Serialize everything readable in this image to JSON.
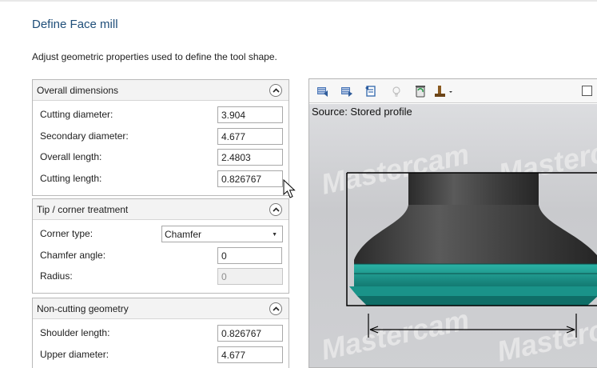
{
  "header": {
    "title": "Define Face mill",
    "description": "Adjust geometric properties used to define the tool shape."
  },
  "sections": {
    "overall": {
      "title": "Overall dimensions",
      "cutting_diameter": {
        "label": "Cutting diameter:",
        "value": "3.904"
      },
      "secondary_diameter": {
        "label": "Secondary diameter:",
        "value": "4.677"
      },
      "overall_length": {
        "label": "Overall length:",
        "value": "2.4803"
      },
      "cutting_length": {
        "label": "Cutting length:",
        "value": "0.826767"
      }
    },
    "tip": {
      "title": "Tip / corner treatment",
      "corner_type": {
        "label": "Corner type:",
        "value": "Chamfer"
      },
      "chamfer_angle": {
        "label": "Chamfer angle:",
        "value": "0"
      },
      "radius": {
        "label": "Radius:",
        "value": "0"
      }
    },
    "noncutting": {
      "title": "Non-cutting geometry",
      "shoulder_length": {
        "label": "Shoulder length:",
        "value": "0.826767"
      },
      "upper_diameter": {
        "label": "Upper diameter:",
        "value": "4.677"
      }
    }
  },
  "viewer": {
    "source_label": "Source: Stored profile",
    "watermark": "Mastercam"
  },
  "colors": {
    "title": "#1f4e79",
    "tool_body": "#3a3a3a",
    "tool_insert": "#1f9a91",
    "viewport_bg": "#cfd0d3"
  },
  "icons": [
    "import-left-icon",
    "import-right-icon",
    "load-profile-icon",
    "lightbulb-icon",
    "recycle-icon",
    "tool-display-icon"
  ]
}
